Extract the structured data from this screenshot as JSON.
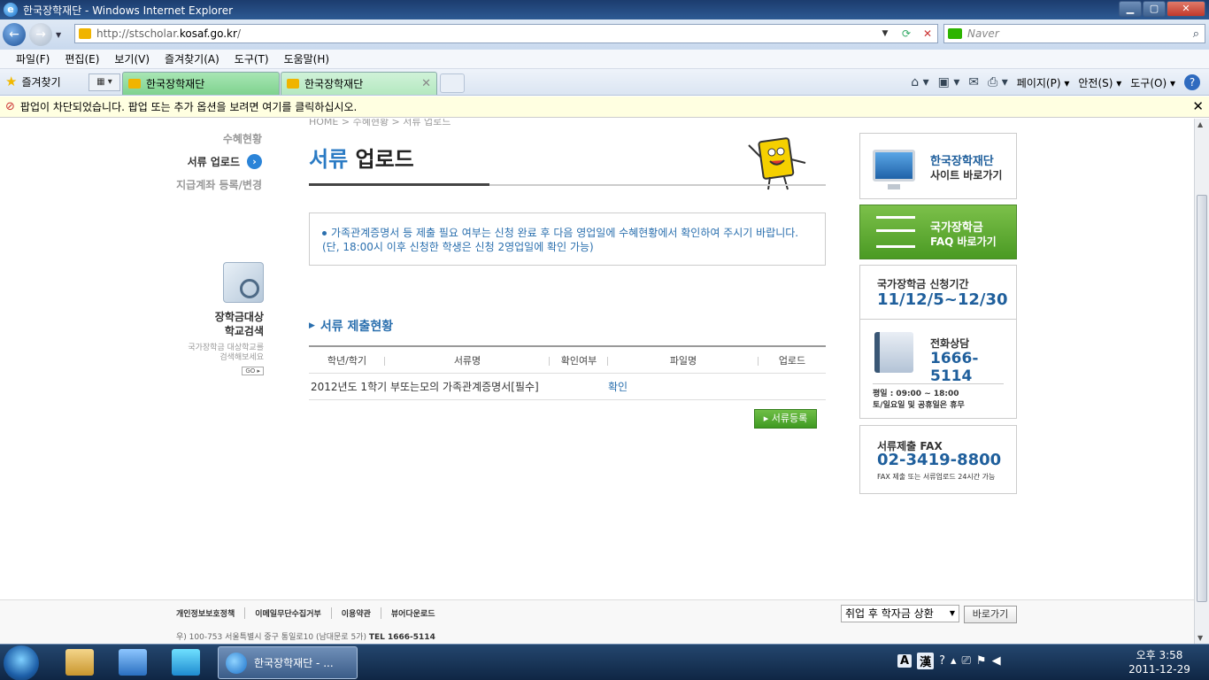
{
  "window": {
    "title": "한국장학재단 - Windows Internet Explorer",
    "controls": {
      "minimize": "▁",
      "maximize": "▢",
      "close": "✕"
    }
  },
  "address_bar": {
    "url_prefix": "http://stscholar.",
    "url_domain": "kosaf.go.kr",
    "url_suffix": "/",
    "search_placeholder": "Naver"
  },
  "menu": [
    "파일(F)",
    "편집(E)",
    "보기(V)",
    "즐겨찾기(A)",
    "도구(T)",
    "도움말(H)"
  ],
  "favorites_label": "즐겨찾기",
  "tabs": [
    {
      "label": "한국장학재단"
    },
    {
      "label": "한국장학재단"
    }
  ],
  "command_bar": {
    "page": "페이지(P)",
    "safety": "안전(S)",
    "tools": "도구(O)"
  },
  "infobar_text": "팝업이 차단되었습니다. 팝업 또는 추가 옵션을 보려면 여기를 클릭하십시오.",
  "breadcrumb": "HOME > 수혜현황 > 서류 업로드",
  "left_nav": {
    "items": [
      {
        "label": "수혜현황"
      },
      {
        "label": "서류 업로드",
        "active": true
      },
      {
        "label": "지급계좌 등록/변경"
      }
    ]
  },
  "school_search": {
    "title_line1": "장학금대상",
    "title_line2": "학교검색",
    "sub_line1": "국가장학금 대상학교를",
    "sub_line2": "검색해보세요",
    "go": "GO ▸"
  },
  "page_title": {
    "highlight": "서류",
    "rest": " 업로드"
  },
  "notice": {
    "text_main": "가족관계증명서 등 제출 필요 여부는 신청 완료 후 다음 영업일에 수혜현황에서 확인하여 주시기 바랍니다.",
    "text_note": "(단, 18:00시 이후 신청한 학생은 신청 2영업일에 확인 가능)"
  },
  "section_title": "서류 제출현황",
  "table": {
    "headers": [
      "학년/학기",
      "서류명",
      "확인여부",
      "파일명",
      "업로드"
    ],
    "rows": [
      {
        "document": "2012년도 1학기 부또는모의 가족관계증명서[필수]",
        "status": "확인"
      }
    ]
  },
  "register_button": "▸ 서류등록",
  "right_banners": {
    "site": {
      "line1": "한국장학재단",
      "line2": "사이트 바로가기"
    },
    "faq": {
      "line1": "국가장학금",
      "line2": "FAQ 바로가기"
    },
    "period": {
      "line1": "국가장학금 신청기간",
      "line2": "11/12/5~12/30"
    },
    "phone": {
      "line1": "전화상담",
      "line2": "1666-5114",
      "hours1": "평일 : 09:00 ~ 18:00",
      "hours2": "토/일요일 및 공휴일은 휴무"
    },
    "fax": {
      "line1": "서류제출 FAX",
      "line2": "02-3419-8800",
      "line3": "FAX 제출 또는 서류업로드 24시간 가능"
    }
  },
  "footer": {
    "links": [
      "개인정보보호정책",
      "이메일무단수집거부",
      "이용약관",
      "뷰어다운로드"
    ],
    "address": "우) 100-753  서울특별시 중구 통일로10 (남대문로 5가)",
    "tel": "TEL 1666-5114",
    "select_value": "취업 후 학자금 상환",
    "go_button": "바로가기"
  },
  "taskbar": {
    "active_item": "한국장학재단 - ...",
    "clock_time": "오후 3:58",
    "clock_date": "2011-12-29",
    "ime_a": "A",
    "ime_han": "漢"
  },
  "colors": {
    "accent_blue": "#2a6fae",
    "title_blue": "#2b7bc4",
    "green_button": "#4a9a23"
  }
}
